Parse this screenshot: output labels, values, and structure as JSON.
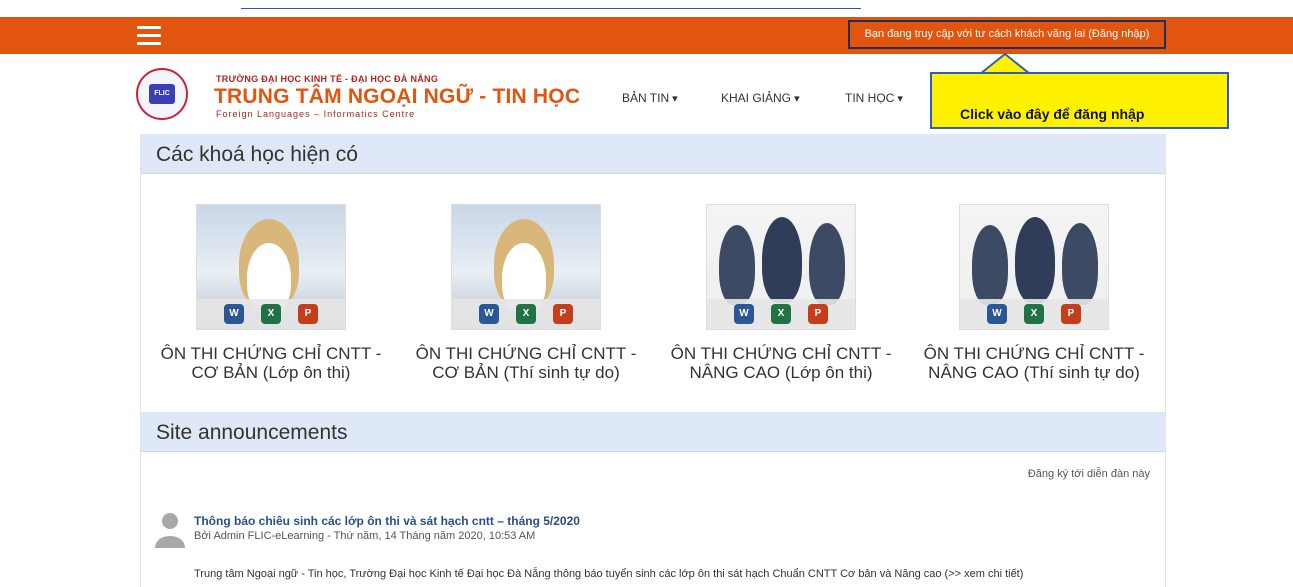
{
  "guest_notice": "Bạn đang truy cập với tư cách khách vãng lai (Đăng nhập)",
  "logo": {
    "top_line": "TRƯỜNG ĐẠI HỌC KINH TẾ - ĐẠI HỌC ĐÀ NẴNG",
    "main_line": "TRUNG TÂM NGOẠI NGỮ - TIN HỌC",
    "sub_line": "Foreign Languages – Informatics Centre",
    "badge": "FLIC"
  },
  "nav": [
    "BẢN TIN",
    "KHAI GIẢNG",
    "TIN HỌC"
  ],
  "callout": "Click vào đây để đăng nhập",
  "courses_heading": "Các khoá học hiện có",
  "courses": [
    {
      "line1": "ÔN THI CHỨNG CHỈ CNTT -",
      "line2": "CƠ BẢN (Lớp ôn thi)"
    },
    {
      "line1": "ÔN THI CHỨNG CHỈ CNTT -",
      "line2": "CƠ BẢN (Thí sinh tự do)"
    },
    {
      "line1": "ÔN THI CHỨNG CHỈ CNTT -",
      "line2": "NÂNG CAO (Lớp ôn thi)"
    },
    {
      "line1": "ÔN THI CHỨNG CHỈ CNTT -",
      "line2": "NÂNG CAO (Thí sinh tự do)"
    }
  ],
  "office_icons": [
    "W",
    "X",
    "P"
  ],
  "announcements_heading": "Site announcements",
  "subscribe_link": "Đăng ký tới diễn đàn này",
  "post": {
    "title": "Thông báo chiêu sinh các lớp ôn thi và sát hạch cntt – tháng 5/2020",
    "meta": "Bởi Admin FLIC-eLearning - Thứ năm, 14 Tháng năm 2020, 10:53 AM",
    "body": "Trung tâm Ngoại ngữ - Tin học, Trường Đại học Kinh tế Đại học Đà Nẵng thông báo tuyển sinh các lớp ôn thi sát hạch Chuẩn CNTT Cơ bản và Nâng cao (>> xem chi tiết)"
  },
  "colors": {
    "topbar": "#e2550f",
    "callout": "#fff200",
    "section": "#dfe8f6"
  }
}
